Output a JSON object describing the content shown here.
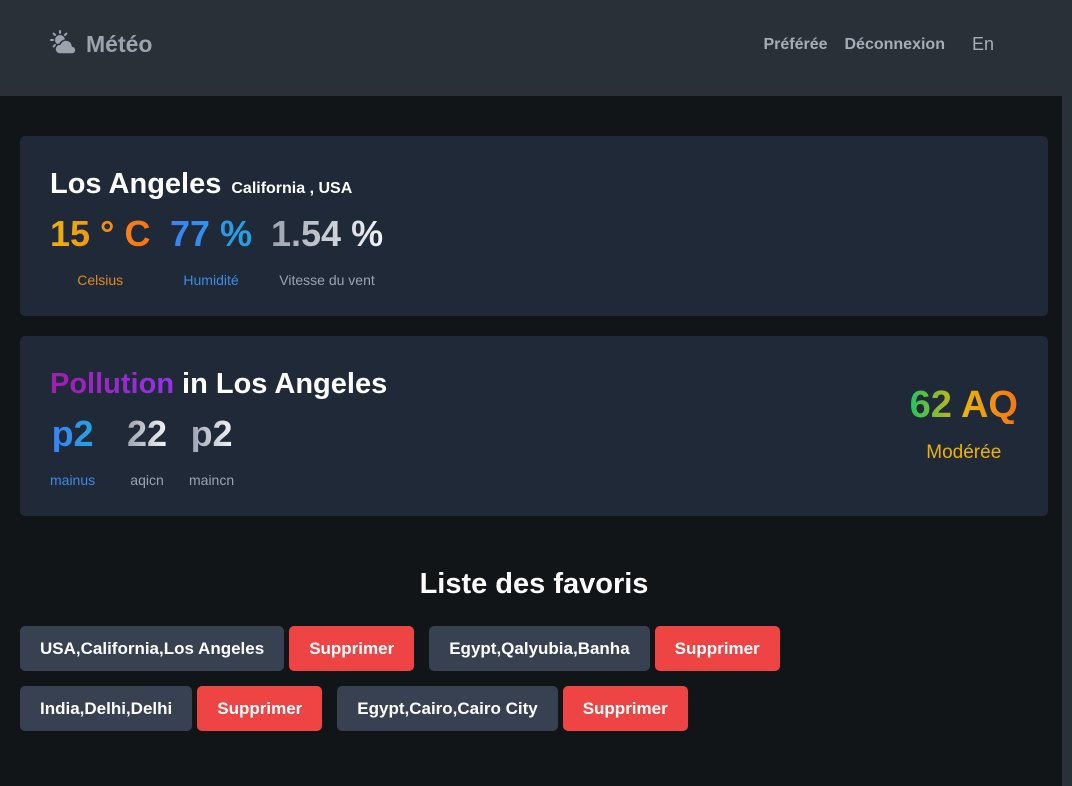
{
  "header": {
    "brand": "Météo",
    "brand_icon": "sun-behind-cloud-icon",
    "nav": [
      "Préférée",
      "Déconnexion"
    ],
    "language": "En"
  },
  "weather": {
    "city": "Los Angeles",
    "region": "California , USA",
    "temperature": "15 ° C",
    "temperature_label": "Celsius",
    "humidity": "77 %",
    "humidity_label": "Humidité",
    "wind": "1.54 %",
    "wind_label": "Vitesse du vent"
  },
  "pollution": {
    "title_highlight": "Pollution",
    "title_rest": "in Los Angeles",
    "metrics": [
      {
        "value": "p2",
        "label": "mainus"
      },
      {
        "value": "22",
        "label": "aqicn"
      },
      {
        "value": "p2",
        "label": "maincn"
      }
    ],
    "aq_value": "62 AQ",
    "aq_label": "Modérée"
  },
  "favorites": {
    "title": "Liste des favoris",
    "delete_label": "Supprimer",
    "items": [
      "USA,California,Los Angeles",
      "Egypt,Qalyubia,Banha",
      "India,Delhi,Delhi",
      "Egypt,Cairo,Cairo City"
    ]
  },
  "colors": {
    "background": "#121518",
    "navbar": "#2a3038",
    "card": "#202938",
    "chip": "#374151",
    "danger": "#ef4444",
    "aq_label": "#eab308"
  }
}
